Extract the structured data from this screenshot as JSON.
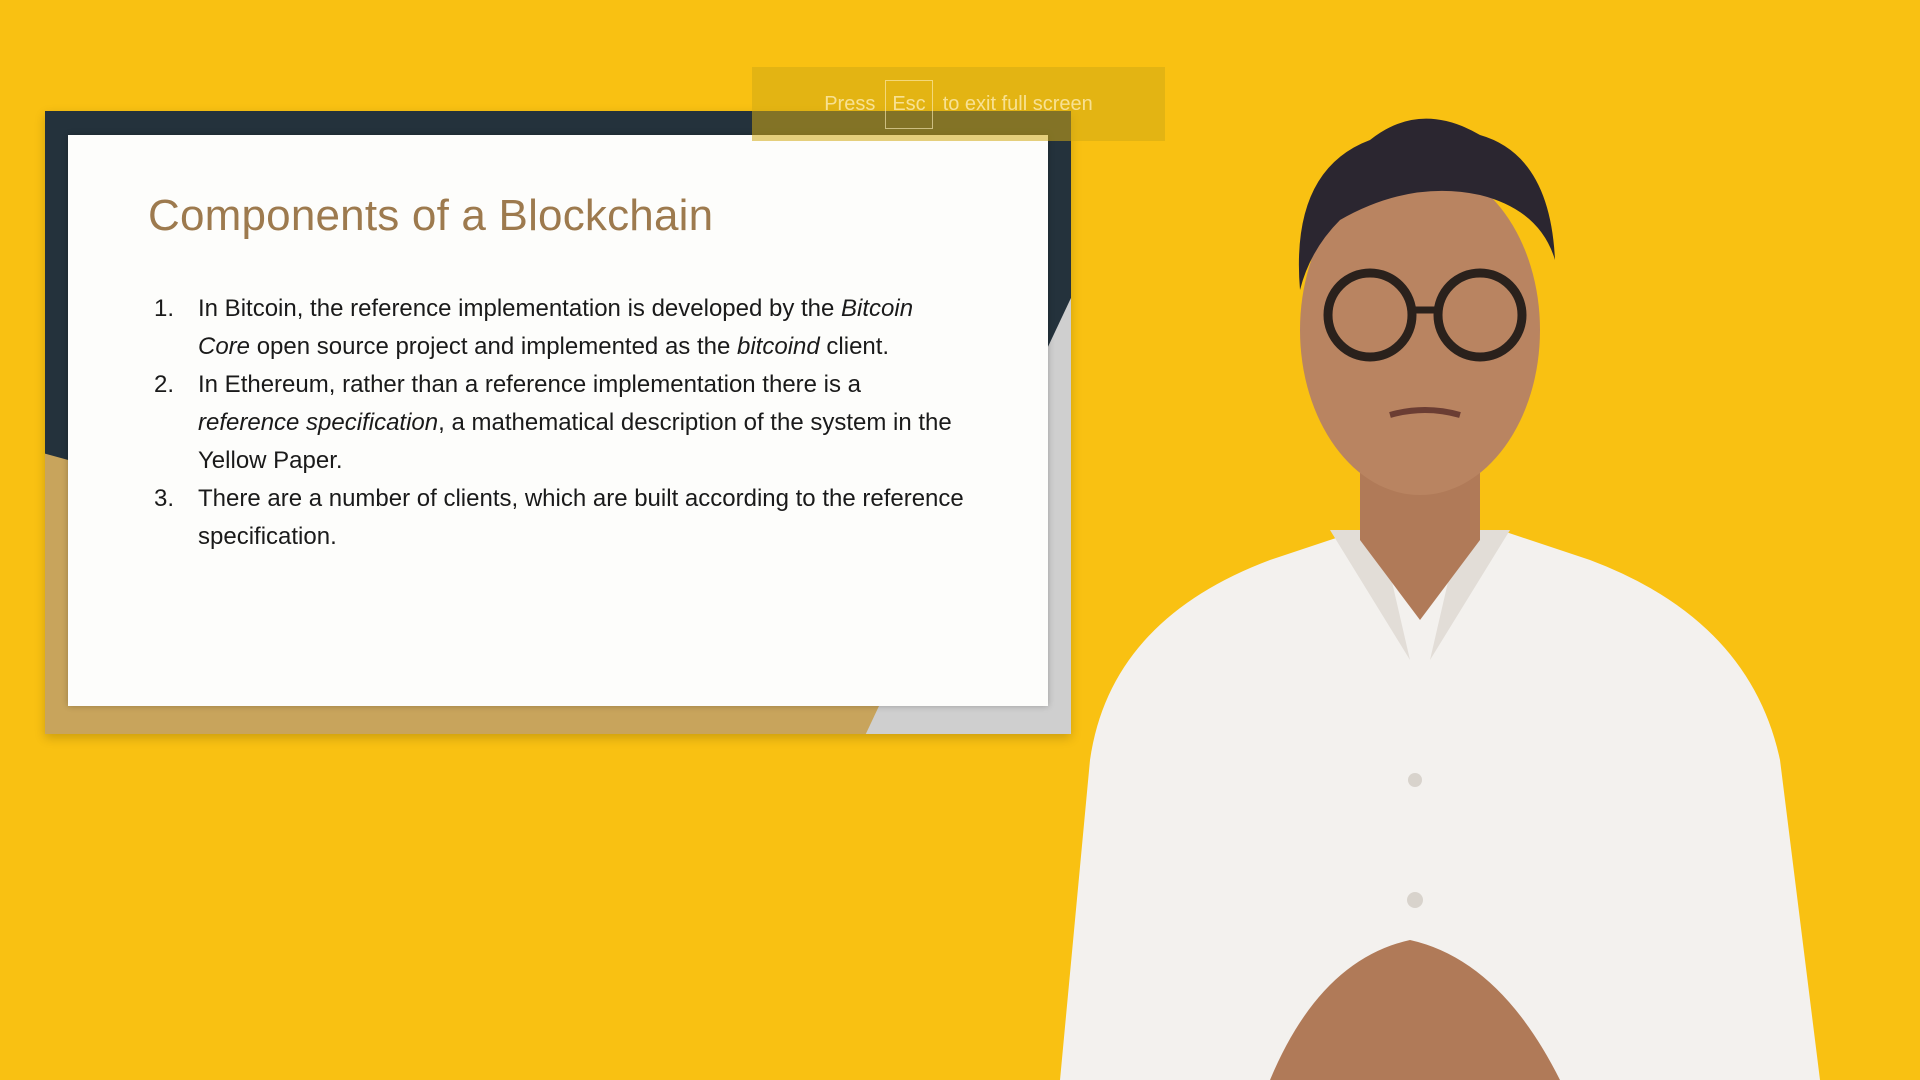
{
  "fullscreen_hint": {
    "press": "Press",
    "key": "Esc",
    "suffix": "to exit full screen"
  },
  "slide": {
    "title": "Components of a Blockchain",
    "items": [
      {
        "number": "1.",
        "parts": [
          {
            "text": "In Bitcoin, the reference implementation is developed by the ",
            "italic": false
          },
          {
            "text": "Bitcoin Core",
            "italic": true
          },
          {
            "text": " open source project and implemented as the ",
            "italic": false
          },
          {
            "text": "bitcoind",
            "italic": true
          },
          {
            "text": " client.",
            "italic": false
          }
        ]
      },
      {
        "number": "2.",
        "parts": [
          {
            "text": "In Ethereum, rather than a reference implementation there is a ",
            "italic": false
          },
          {
            "text": "reference specification",
            "italic": true
          },
          {
            "text": ", a mathematical description of the system in the Yellow Paper.",
            "italic": false
          }
        ]
      },
      {
        "number": "3.",
        "parts": [
          {
            "text": "There are a number of clients, which are built according to the reference specification.",
            "italic": false
          }
        ]
      }
    ]
  },
  "colors": {
    "background": "#f9c112",
    "title": "#9d7a4e",
    "frame_dark": "#24323c",
    "frame_gold": "#c8a45c"
  }
}
